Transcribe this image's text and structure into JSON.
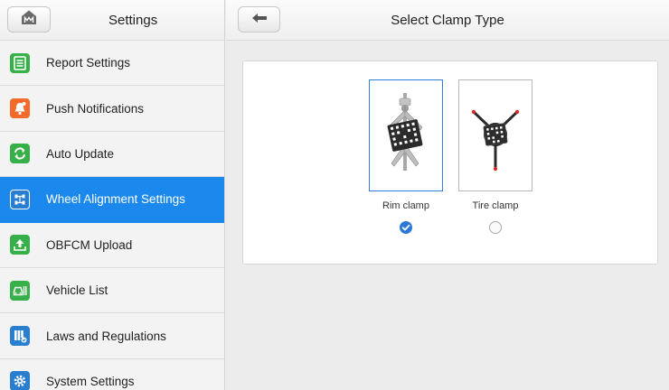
{
  "sidebar": {
    "title": "Settings",
    "home_icon": "home-icon",
    "items": [
      {
        "label": "Report Settings",
        "icon": "report-icon",
        "color": "#38b04a"
      },
      {
        "label": "Push Notifications",
        "icon": "bell-icon",
        "color": "#f26b2a"
      },
      {
        "label": "Auto Update",
        "icon": "refresh-icon",
        "color": "#38b04a"
      },
      {
        "label": "Wheel Alignment Settings",
        "icon": "wheel-alignment-icon",
        "color": "#2a7ed0",
        "active": true
      },
      {
        "label": "OBFCM Upload",
        "icon": "upload-icon",
        "color": "#38b04a"
      },
      {
        "label": "Vehicle List",
        "icon": "vehicle-list-icon",
        "color": "#38b04a"
      },
      {
        "label": "Laws and Regulations",
        "icon": "laws-icon",
        "color": "#2a7ed0"
      },
      {
        "label": "System Settings",
        "icon": "gear-icon",
        "color": "#2a7ed0"
      }
    ]
  },
  "main": {
    "title": "Select Clamp Type",
    "back_icon": "back-arrow-icon",
    "options": [
      {
        "label": "Rim clamp",
        "selected": true
      },
      {
        "label": "Tire clamp",
        "selected": false
      }
    ]
  },
  "colors": {
    "accent": "#1b88ee",
    "selected_border": "#2f7fe0"
  }
}
